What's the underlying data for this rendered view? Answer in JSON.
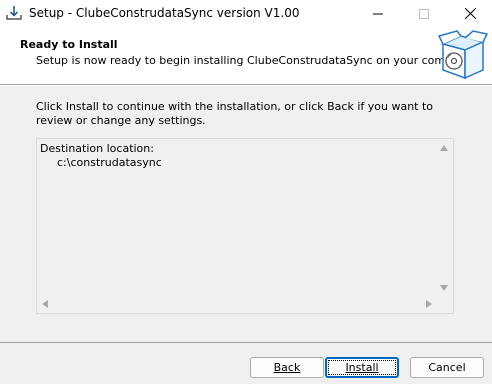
{
  "window": {
    "title": "Setup - ClubeConstrudataSync version V1.00"
  },
  "header": {
    "title": "Ready to Install",
    "subtitle": "Setup is now ready to begin installing ClubeConstrudataSync on your computer."
  },
  "main": {
    "intro": "Click Install to continue with the installation, or click Back if you want to review or change any settings.",
    "memo_heading": "Destination location:",
    "memo_value": "c:\\construdatasync"
  },
  "buttons": {
    "back": "Back",
    "install": "Install",
    "cancel": "Cancel"
  },
  "icons": {
    "app": "installer-download-icon",
    "logo": "setup-box-disc-icon",
    "minimize": "minimize-icon",
    "maximize": "maximize-icon",
    "close": "close-icon"
  },
  "colors": {
    "accent": "#0067c0",
    "panel": "#f0f0f0"
  }
}
